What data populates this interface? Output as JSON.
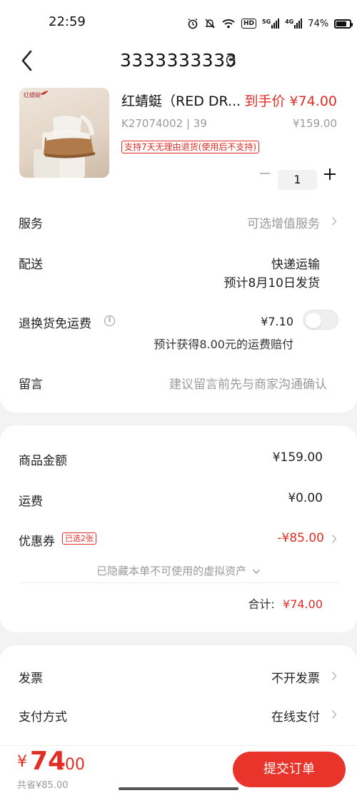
{
  "status_bar": {
    "time": "22:59",
    "battery": "74%",
    "battery_level": 0.74,
    "signal1_label": "5G",
    "signal2_label": "4G",
    "hd_label": "HD",
    "icons": [
      "alarm-icon",
      "mute-bell-icon",
      "wifi-icon",
      "hd-icon",
      "signal-5g-icon",
      "signal-4g-icon",
      "battery-icon"
    ]
  },
  "header": {
    "title": "3333333333",
    "back_icon": "chevron-left-icon",
    "location_icon": "location-pin-icon"
  },
  "product": {
    "name": "红蜻蜓（RED DR...",
    "price_label": "到手价 ¥74.00",
    "sku": "K27074002 | 39",
    "original_price": "¥159.00",
    "return_tag": "支持7天无理由退货(使用后不支持)",
    "quantity": "1",
    "brand_logo_text": "红蜻蜓"
  },
  "rows": {
    "service_label": "服务",
    "service_value": "可选增值服务",
    "delivery_label": "配送",
    "delivery_value": "快递运输",
    "delivery_date": "预计8月10日发货",
    "return_shipping_label": "退换货免运费",
    "return_shipping_price": "¥7.10",
    "return_shipping_note": "预计获得8.00元的运费赔付",
    "return_shipping_enabled": false,
    "message_label": "留言",
    "message_placeholder": "建议留言前先与商家沟通确认"
  },
  "summary": {
    "goods_amount_label": "商品金额",
    "goods_amount": "¥159.00",
    "shipping_label": "运费",
    "shipping": "¥0.00",
    "coupon_label": "优惠券",
    "coupon_badge": "已选2张",
    "coupon_value": "-¥85.00",
    "hidden_assets": "已隐藏本单不可使用的虚拟资产",
    "total_label": "合计:",
    "total_value": "¥74.00"
  },
  "other": {
    "invoice_label": "发票",
    "invoice_value": "不开发票",
    "payment_label": "支付方式",
    "payment_value": "在线支付"
  },
  "bottom_bar": {
    "currency": "¥",
    "price_int": "74",
    "price_dec": ".00",
    "saved": "共省¥85.00",
    "submit_label": "提交订单"
  },
  "colors": {
    "accent_red": "#e02e24",
    "button_red": "#e8342a",
    "background": "#f3f3f3"
  }
}
